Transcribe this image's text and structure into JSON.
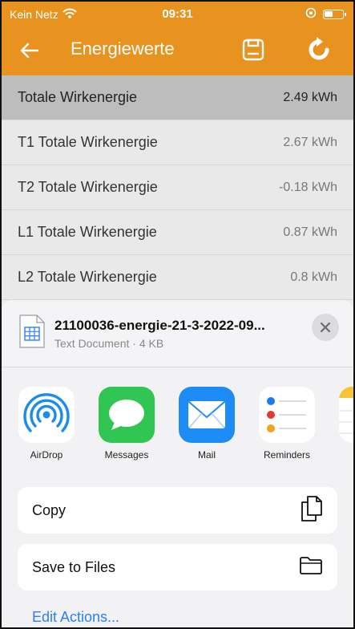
{
  "status_bar": {
    "carrier": "Kein Netz",
    "time": "09:31"
  },
  "header": {
    "title": "Energiewerte",
    "accent": "#e8921f"
  },
  "energy_rows": [
    {
      "label": "Totale Wirkenergie",
      "value": "2.49 kWh"
    },
    {
      "label": "T1 Totale Wirkenergie",
      "value": "2.67 kWh"
    },
    {
      "label": "T2 Totale Wirkenergie",
      "value": "-0.18 kWh"
    },
    {
      "label": "L1 Totale Wirkenergie",
      "value": "0.87 kWh"
    },
    {
      "label": "L2 Totale Wirkenergie",
      "value": "0.8 kWh"
    }
  ],
  "share_sheet": {
    "file_name": "21100036-energie-21-3-2022-09...",
    "file_meta": "Text Document · 4 KB",
    "apps": [
      {
        "name": "AirDrop",
        "icon": "airdrop-icon"
      },
      {
        "name": "Messages",
        "icon": "messages-icon"
      },
      {
        "name": "Mail",
        "icon": "mail-icon"
      },
      {
        "name": "Reminders",
        "icon": "reminders-icon"
      },
      {
        "name": "",
        "icon": "notes-icon"
      }
    ],
    "actions": [
      {
        "label": "Copy",
        "icon": "copy-icon"
      },
      {
        "label": "Save to Files",
        "icon": "folder-icon"
      }
    ],
    "edit_actions_label": "Edit Actions..."
  }
}
